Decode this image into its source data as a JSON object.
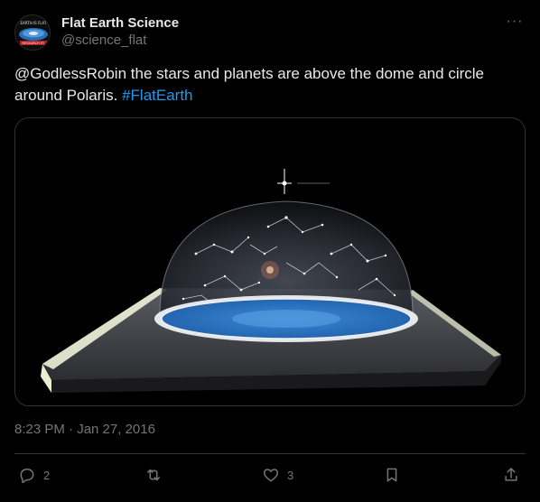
{
  "author": {
    "display_name": "Flat Earth Science",
    "handle": "@science_flat",
    "avatar_text_top": "EARTH IS FLAT",
    "avatar_text_bottom": "RESEARCH IT!"
  },
  "tweet": {
    "text_before": "@GodlessRobin the stars and planets are above the dome and circle around Polaris. ",
    "hashtag": "#FlatEarth",
    "timestamp": "8:23 PM · Jan 27, 2016"
  },
  "media": {
    "icon": "flat-earth-dome-model-photo"
  },
  "actions": {
    "reply_count": "2",
    "retweet_count": "",
    "like_count": "3"
  },
  "colors": {
    "background": "#000000",
    "text": "#e7e9ea",
    "secondary": "#71767b",
    "link": "#1d9bf0",
    "border": "#2f3336"
  }
}
